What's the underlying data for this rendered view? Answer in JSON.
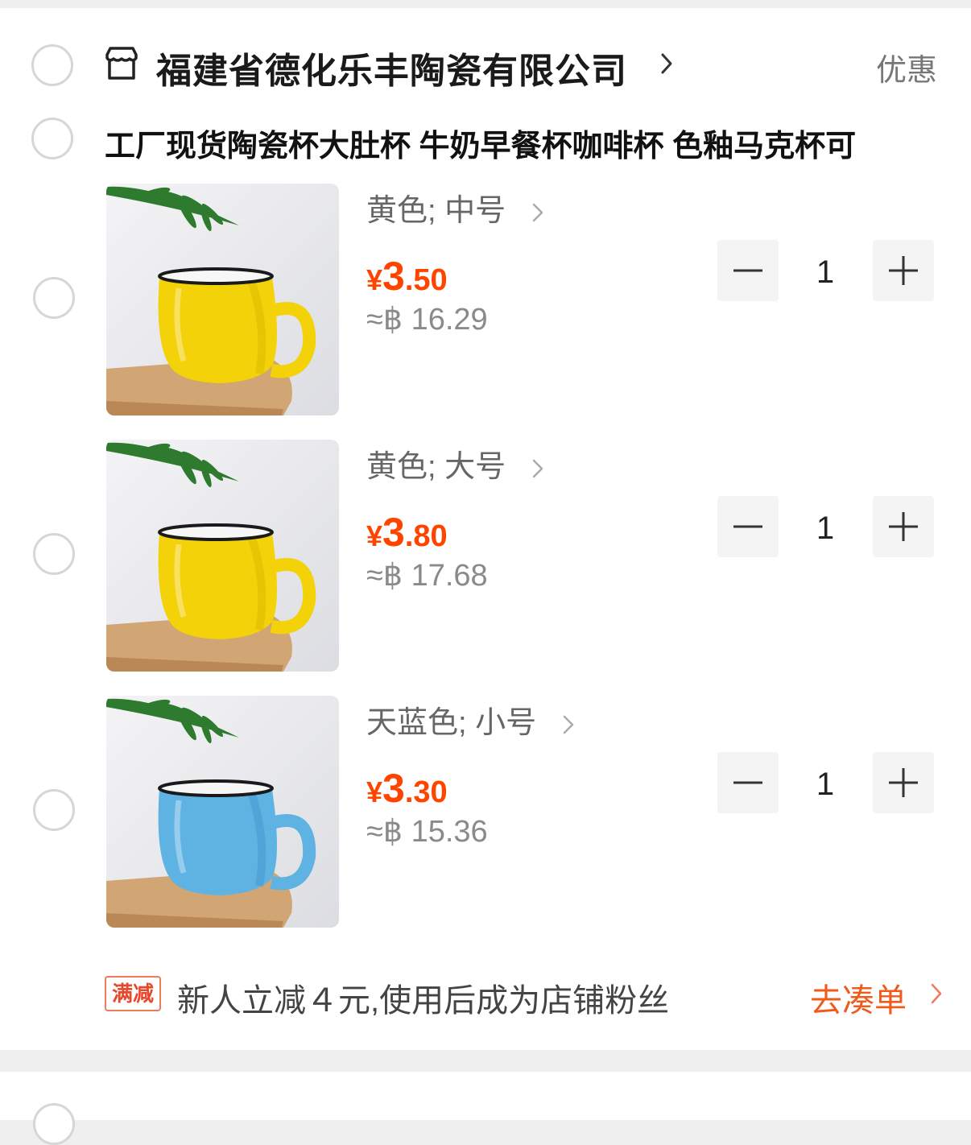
{
  "shop": {
    "name": "福建省德化乐丰陶瓷有限公司",
    "discount_link": "优惠"
  },
  "product": {
    "title": "工厂现货陶瓷杯大肚杯 牛奶早餐杯咖啡杯 色釉马克杯可"
  },
  "items": [
    {
      "variant": "黄色; 中号",
      "currency": "¥",
      "price_int": "3",
      "price_dec": ".50",
      "converted": "≈฿ 16.29",
      "quantity": "1",
      "mug_color": "#f3d20a",
      "mug_shade": "#d9b800"
    },
    {
      "variant": "黄色; 大号",
      "currency": "¥",
      "price_int": "3",
      "price_dec": ".80",
      "converted": "≈฿ 17.68",
      "quantity": "1",
      "mug_color": "#f3d20a",
      "mug_shade": "#d9b800"
    },
    {
      "variant": "天蓝色; 小号",
      "currency": "¥",
      "price_int": "3",
      "price_dec": ".30",
      "converted": "≈฿ 15.36",
      "quantity": "1",
      "mug_color": "#5fb3e3",
      "mug_shade": "#3f97cc"
    }
  ],
  "promo": {
    "badge": "满减",
    "text": "新人立减４元,使用后成为店铺粉丝",
    "link": "去凑单"
  },
  "colors": {
    "price": "#ff4400",
    "accent": "#f05a1a"
  },
  "icons": {
    "shop": "storefront-icon",
    "chevron": "chevron-right-icon",
    "minus": "minus-icon",
    "plus": "plus-icon"
  }
}
